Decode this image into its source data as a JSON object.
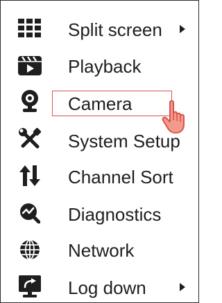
{
  "menu": {
    "items": [
      {
        "label": "Split screen",
        "icon": "grid-icon",
        "has_submenu": true
      },
      {
        "label": "Playback",
        "icon": "clapperboard-icon",
        "has_submenu": false
      },
      {
        "label": "Camera",
        "icon": "webcam-icon",
        "has_submenu": false
      },
      {
        "label": "System Setup",
        "icon": "tools-icon",
        "has_submenu": false
      },
      {
        "label": "Channel Sort",
        "icon": "sort-arrows-icon",
        "has_submenu": false
      },
      {
        "label": "Diagnostics",
        "icon": "diagnostics-icon",
        "has_submenu": false
      },
      {
        "label": "Network",
        "icon": "globe-icon",
        "has_submenu": false
      },
      {
        "label": "Log down",
        "icon": "logout-monitor-icon",
        "has_submenu": true
      }
    ],
    "highlighted_item": "Camera",
    "cursor": "hand-pointer-icon"
  },
  "colors": {
    "text": "#1e1e1e",
    "highlight_border": "#d9534f",
    "cursor_fill": "#f39a8a",
    "cursor_outline": "#d9534f"
  }
}
